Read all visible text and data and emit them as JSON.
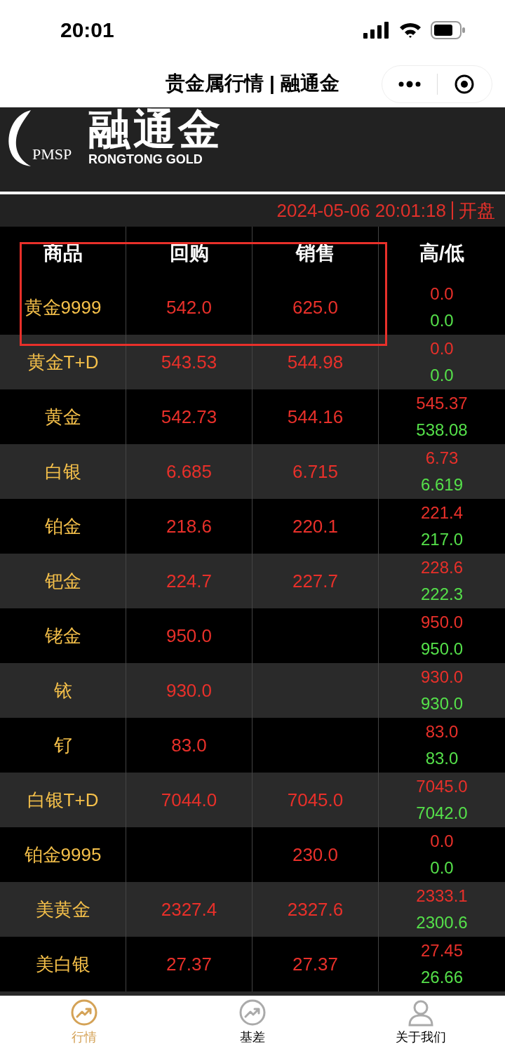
{
  "status_bar": {
    "time": "20:01"
  },
  "title_bar": {
    "title": "贵金属行情 | 融通金"
  },
  "logo": {
    "mark": "PMSP",
    "name": "融通金",
    "subtitle": "RONGTONG GOLD"
  },
  "info_bar": {
    "timestamp": "2024-05-06 20:01:18",
    "status": "开盘"
  },
  "table": {
    "columns": [
      "商品",
      "回购",
      "销售",
      "高/低"
    ],
    "highlight": {
      "kind": "rectangle"
    },
    "rows": [
      {
        "name": "黄金9999",
        "buy": "542.0",
        "sell": "625.0",
        "high": "0.0",
        "low": "0.0"
      },
      {
        "name": "黄金T+D",
        "buy": "543.53",
        "sell": "544.98",
        "high": "0.0",
        "low": "0.0"
      },
      {
        "name": "黄金",
        "buy": "542.73",
        "sell": "544.16",
        "high": "545.37",
        "low": "538.08"
      },
      {
        "name": "白银",
        "buy": "6.685",
        "sell": "6.715",
        "high": "6.73",
        "low": "6.619"
      },
      {
        "name": "铂金",
        "buy": "218.6",
        "sell": "220.1",
        "high": "221.4",
        "low": "217.0"
      },
      {
        "name": "钯金",
        "buy": "224.7",
        "sell": "227.7",
        "high": "228.6",
        "low": "222.3"
      },
      {
        "name": "铑金",
        "buy": "950.0",
        "sell": "",
        "high": "950.0",
        "low": "950.0"
      },
      {
        "name": "铱",
        "buy": "930.0",
        "sell": "",
        "high": "930.0",
        "low": "930.0"
      },
      {
        "name": "钌",
        "buy": "83.0",
        "sell": "",
        "high": "83.0",
        "low": "83.0"
      },
      {
        "name": "白银T+D",
        "buy": "7044.0",
        "sell": "7045.0",
        "high": "7045.0",
        "low": "7042.0"
      },
      {
        "name": "铂金9995",
        "buy": "",
        "sell": "230.0",
        "high": "0.0",
        "low": "0.0"
      },
      {
        "name": "美黄金",
        "buy": "2327.4",
        "sell": "2327.6",
        "high": "2333.1",
        "low": "2300.6"
      },
      {
        "name": "美白银",
        "buy": "27.37",
        "sell": "27.37",
        "high": "27.45",
        "low": "26.66"
      }
    ]
  },
  "tab_bar": [
    {
      "label": "行情",
      "kind": "chart",
      "selected": true
    },
    {
      "label": "基差",
      "kind": "chart",
      "selected": false
    },
    {
      "label": "关于我们",
      "kind": "person",
      "selected": false
    }
  ]
}
